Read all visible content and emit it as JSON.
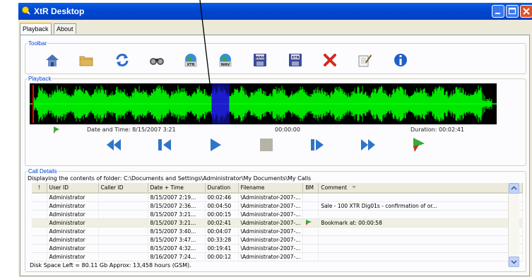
{
  "window": {
    "title": "XtR Desktop"
  },
  "tabs": [
    {
      "label": "Playback",
      "active": true
    },
    {
      "label": "About",
      "active": false
    }
  ],
  "toolbar": {
    "legend": "Toolbar",
    "icons": [
      "home-icon",
      "open-folder-icon",
      "refresh-icon",
      "search-binoculars-icon",
      "globe-xtr-icon",
      "globe-wav-icon",
      "save-wav-icon",
      "save-xtr-icon",
      "delete-icon",
      "edit-comment-icon",
      "info-icon"
    ],
    "labels": {
      "xtr": "XTR",
      "wav": "WAV"
    }
  },
  "playback": {
    "legend": "Playback",
    "datetime": "Date and Time:  8/15/2007 3:21",
    "position": "00:00:00",
    "duration": "Duration:  00:02:41",
    "colors": {
      "waveform": "#00ff00",
      "selection": "#1f1fd8",
      "background": "#000000",
      "marker": "#ff0000"
    }
  },
  "call_details": {
    "legend": "Call Details",
    "folder_text": "Displaying the contents of folder:   C:\\Documents and Settings\\Administrator\\My Documents\\My Calls",
    "columns": [
      "!",
      "User ID",
      "Caller ID",
      "Date + Time",
      "Duration",
      "Filename",
      "BM",
      "Comment"
    ],
    "rows": [
      {
        "user": "Administrator",
        "caller": "",
        "date": "8/15/2007 2:19...",
        "duration": "00:02:46",
        "filename": "\\Administrator-2007-...",
        "bm": false,
        "comment": ""
      },
      {
        "user": "Administrator",
        "caller": "",
        "date": "8/15/2007 2:36...",
        "duration": "00:04:50",
        "filename": "\\Administrator-2007-...",
        "bm": false,
        "comment": "Sale - 100 XTR Dig01s - confirmation of or..."
      },
      {
        "user": "Administrator",
        "caller": "",
        "date": "8/15/2007 3:21...",
        "duration": "00:00:15",
        "filename": "\\Administrator-2007-...",
        "bm": false,
        "comment": ""
      },
      {
        "user": "Administrator",
        "caller": "",
        "date": "8/15/2007 3:21...",
        "duration": "00:02:41",
        "filename": "\\Administrator-2007-...",
        "bm": true,
        "comment": "Bookmark at:  00:00:58"
      },
      {
        "user": "Administrator",
        "caller": "",
        "date": "8/15/2007 3:40...",
        "duration": "00:04:07",
        "filename": "\\Administrator-2007-...",
        "bm": false,
        "comment": ""
      },
      {
        "user": "Administrator",
        "caller": "",
        "date": "8/15/2007 3:47...",
        "duration": "00:33:28",
        "filename": "\\Administrator-2007-...",
        "bm": false,
        "comment": ""
      },
      {
        "user": "Administrator",
        "caller": "",
        "date": "8/15/2007 4:32...",
        "duration": "00:19:41",
        "filename": "\\Administrator-2007-...",
        "bm": false,
        "comment": ""
      },
      {
        "user": "Administrator",
        "caller": "",
        "date": "8/16/2007 7:24...",
        "duration": "00:00:12",
        "filename": "\\Administrator-2007-...",
        "bm": false,
        "comment": ""
      }
    ],
    "selected_row": 3,
    "disk_space": "Disk Space Left = 80.11 Gb  Approx: 13,458 hours (GSM)."
  }
}
